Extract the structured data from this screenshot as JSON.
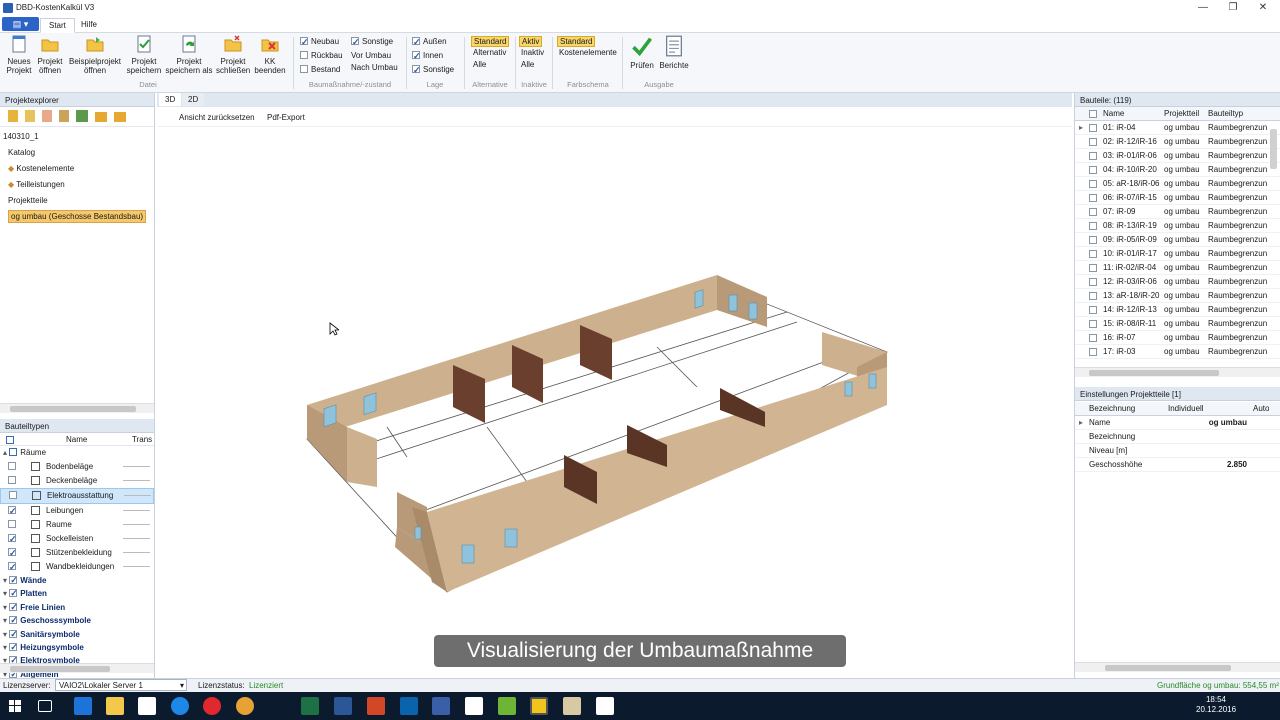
{
  "window": {
    "title": "DBD-KostenKalkül V3"
  },
  "ribbon": {
    "tabs": [
      {
        "label": "Start"
      },
      {
        "label": "Hilfe"
      }
    ],
    "buttons": [
      {
        "label": "Neues\nProjekt"
      },
      {
        "label": "Projekt\nöffnen"
      },
      {
        "label": "Beispielprojekt\nöffnen"
      },
      {
        "label": "Projekt\nspeichern"
      },
      {
        "label": "Projekt\nspeichern als"
      },
      {
        "label": "Projekt\nschließen"
      },
      {
        "label": "KK\nbeenden"
      }
    ],
    "group_datei": "Datei",
    "baumassnahme": {
      "label": "Baumaßnahme/-zustand",
      "neubau": "Neubau",
      "rueckbau": "Rückbau",
      "bestand": "Bestand",
      "sonstige": "Sonstige",
      "vor_umbau": "Vor Umbau",
      "nach_umbau": "Nach Umbau"
    },
    "lage": {
      "label": "Lage",
      "aussen": "Außen",
      "innen": "Innen",
      "sonstige": "Sonstige"
    },
    "alternative": {
      "label": "Alternative",
      "standard": "Standard",
      "alternativ": "Alternativ",
      "alle": "Alle"
    },
    "inaktive": {
      "label": "Inaktive",
      "aktiv": "Aktiv",
      "inaktiv": "Inaktiv",
      "alle": "Alle"
    },
    "farbschema": {
      "label": "Farbschema",
      "standard": "Standard",
      "kostenelemente": "Kostenelemente"
    },
    "ausgabe": {
      "label": "Ausgabe",
      "pruefen": "Prüfen",
      "berichte": "Berichte"
    }
  },
  "projektexplorer": {
    "title": "Projektexplorer",
    "root": "140310_1",
    "katalog": "Katalog",
    "kostenelemente": "Kostenelemente",
    "teilleistungen": "Teilleistungen",
    "projektteile": "Projektteile",
    "selected": "og umbau (Geschosse Bestandsbau)"
  },
  "bauteiltypen": {
    "title": "Bauteiltypen",
    "col_name": "Name",
    "col_trans": "Trans",
    "raeume": "Räume",
    "sub": [
      {
        "name": "Bodenbeläge",
        "checked": false
      },
      {
        "name": "Deckenbeläge",
        "checked": false
      },
      {
        "name": "Elektroausstattung",
        "checked": false
      },
      {
        "name": "Leibungen",
        "checked": true
      },
      {
        "name": "Raume",
        "checked": false
      },
      {
        "name": "Sockelleisten",
        "checked": true
      },
      {
        "name": "Stützenbekleidung",
        "checked": true
      },
      {
        "name": "Wandbekleidungen",
        "checked": true
      }
    ],
    "groups": [
      {
        "name": "Wände"
      },
      {
        "name": "Platten"
      },
      {
        "name": "Freie Linien"
      },
      {
        "name": "Geschosssymbole"
      },
      {
        "name": "Sanitärsymbole"
      },
      {
        "name": "Heizungsymbole"
      },
      {
        "name": "Elektrosymbole"
      },
      {
        "name": "Allgemein"
      }
    ]
  },
  "viewer": {
    "tab_3d": "3D",
    "tab_2d": "2D",
    "reset": "Ansicht zurücksetzen",
    "pdf": "Pdf-Export",
    "caption": "Visualisierung der Umbaumaßnahme"
  },
  "bauteile": {
    "title": "Bauteile: (119)",
    "cols": {
      "name": "Name",
      "projektteil": "Projektteil",
      "bauteiltyp": "Bauteiltyp"
    },
    "rows": [
      {
        "name": "01: iR-04",
        "pt": "og umbau",
        "typ": "Raumbegrenzun"
      },
      {
        "name": "02: iR-12/iR-16",
        "pt": "og umbau",
        "typ": "Raumbegrenzun"
      },
      {
        "name": "03: iR-01/iR-06",
        "pt": "og umbau",
        "typ": "Raumbegrenzun"
      },
      {
        "name": "04: iR-10/iR-20",
        "pt": "og umbau",
        "typ": "Raumbegrenzun"
      },
      {
        "name": "05: aR-18/iR-06",
        "pt": "og umbau",
        "typ": "Raumbegrenzun"
      },
      {
        "name": "06: iR-07/iR-15",
        "pt": "og umbau",
        "typ": "Raumbegrenzun"
      },
      {
        "name": "07: iR-09",
        "pt": "og umbau",
        "typ": "Raumbegrenzun"
      },
      {
        "name": "08: iR-13/iR-19",
        "pt": "og umbau",
        "typ": "Raumbegrenzun"
      },
      {
        "name": "09: iR-05/iR-09",
        "pt": "og umbau",
        "typ": "Raumbegrenzun"
      },
      {
        "name": "10: iR-01/iR-17",
        "pt": "og umbau",
        "typ": "Raumbegrenzun"
      },
      {
        "name": "11: iR-02/iR-04",
        "pt": "og umbau",
        "typ": "Raumbegrenzun"
      },
      {
        "name": "12: iR-03/iR-06",
        "pt": "og umbau",
        "typ": "Raumbegrenzun"
      },
      {
        "name": "13: aR-18/iR-20",
        "pt": "og umbau",
        "typ": "Raumbegrenzun"
      },
      {
        "name": "14: iR-12/iR-13",
        "pt": "og umbau",
        "typ": "Raumbegrenzun"
      },
      {
        "name": "15: iR-08/iR-11",
        "pt": "og umbau",
        "typ": "Raumbegrenzun"
      },
      {
        "name": "16: iR-07",
        "pt": "og umbau",
        "typ": "Raumbegrenzun"
      },
      {
        "name": "17: iR-03",
        "pt": "og umbau",
        "typ": "Raumbegrenzun"
      }
    ]
  },
  "einstellungen": {
    "title": "Einstellungen Projektteile [1]",
    "cols": {
      "bez": "Bezeichnung",
      "ind": "Individuell",
      "auto": "Auto"
    },
    "rows": [
      {
        "k": "Name",
        "v": "og umbau"
      },
      {
        "k": "Bezeichnung",
        "v": ""
      },
      {
        "k": "Niveau [m]",
        "v": ""
      },
      {
        "k": "Geschosshöhe",
        "v": "2.850"
      }
    ]
  },
  "status": {
    "lizenzserver_label": "Lizenzserver:",
    "lizenzserver_value": "VAIO2\\Lokaler Server 1",
    "lizenzstatus_label": "Lizenzstatus:",
    "lizenzstatus_value": "Lizenziert",
    "grundflaeche": "Grundfläche og umbau: 554,55 m²"
  },
  "taskbar": {
    "time": "18:54",
    "date": "20.12.2016"
  }
}
